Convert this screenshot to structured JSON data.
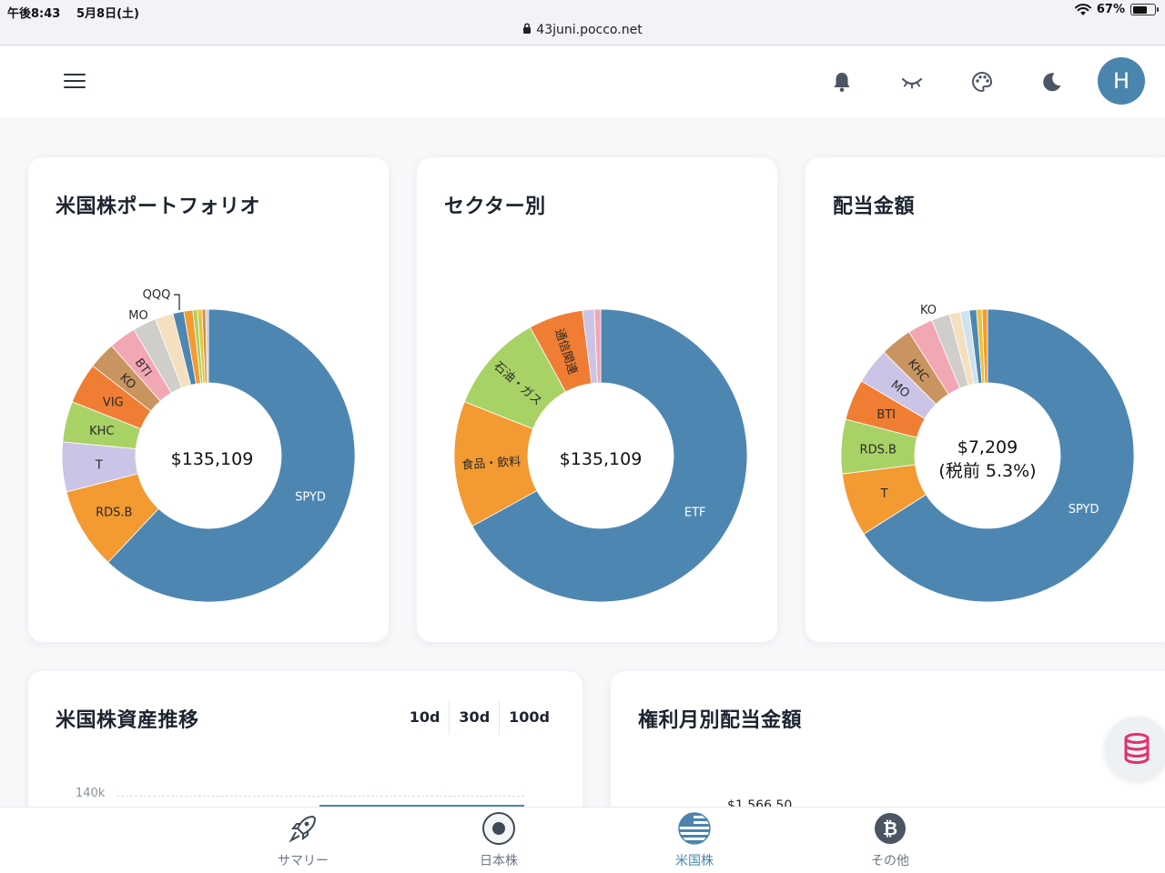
{
  "statusbar": {
    "time": "午後8:43",
    "date": "5月8日(土)",
    "battery": "67%",
    "battery_level": 0.67,
    "url": "43juni.pocco.net"
  },
  "header": {
    "avatar_letter": "H"
  },
  "cards": {
    "portfolio": {
      "title": "米国株ポートフォリオ",
      "center": "$135,109"
    },
    "sector": {
      "title": "セクター別",
      "center": "$135,109"
    },
    "dividend": {
      "title": "配当金額",
      "center_line1": "$7,209",
      "center_line2": "(税前 5.3%)"
    },
    "history": {
      "title": "米国株資産推移",
      "tabs": [
        "10d",
        "30d",
        "100d"
      ],
      "y_tick": "140k"
    },
    "monthly": {
      "title": "権利月別配当金額",
      "first_value": "$1,566.50"
    }
  },
  "chart_data": [
    {
      "type": "pie",
      "title": "米国株ポートフォリオ",
      "categories": [
        "SPYD",
        "RDS.B",
        "T",
        "KHC",
        "VIG",
        "KO",
        "BTI",
        "MO",
        "",
        "QQQ",
        "",
        "",
        "",
        "",
        ""
      ],
      "values": [
        62.0,
        9.0,
        5.5,
        4.5,
        4.5,
        3.0,
        3.0,
        2.6,
        2.0,
        1.2,
        1.0,
        0.5,
        0.5,
        0.4,
        0.3
      ],
      "colors": [
        "#4e86b2",
        "#f39a32",
        "#ccc4e6",
        "#a9d266",
        "#ef7d33",
        "#c9945f",
        "#f2a7b4",
        "#d0cecb",
        "#f4dfbe",
        "#4e86b2",
        "#f39a32",
        "#a9d266",
        "#e9c43a",
        "#d98d3c",
        "#cccccc"
      ],
      "center_label": "$135,109"
    },
    {
      "type": "pie",
      "title": "セクター別",
      "categories": [
        "ETF",
        "食品・飲料",
        "石油・ガス",
        "通信関連",
        "",
        ""
      ],
      "values": [
        67.0,
        14.0,
        11.0,
        6.0,
        1.3,
        0.7
      ],
      "colors": [
        "#4e86b2",
        "#f39a32",
        "#a9d266",
        "#ef7d33",
        "#ccc4e6",
        "#f2a7b4"
      ],
      "center_label": "$135,109"
    },
    {
      "type": "pie",
      "title": "配当金額",
      "categories": [
        "SPYD",
        "T",
        "RDS.B",
        "BTI",
        "MO",
        "KHC",
        "KO",
        "",
        "",
        "",
        "",
        "",
        ""
      ],
      "values": [
        66.0,
        7.0,
        6.0,
        4.5,
        4.0,
        3.5,
        2.8,
        2.0,
        1.2,
        1.0,
        0.8,
        0.6,
        0.6
      ],
      "colors": [
        "#4e86b2",
        "#f39a32",
        "#a9d266",
        "#ef7d33",
        "#ccc4e6",
        "#c9945f",
        "#f2a7b4",
        "#d0cecb",
        "#f4dfbe",
        "#cfe3ef",
        "#4e86b2",
        "#e9c43a",
        "#f39a32"
      ],
      "center_label": "$7,209 (税前 5.3%)"
    }
  ],
  "bottomnav": [
    {
      "label": "サマリー",
      "icon": "rocket-icon",
      "active": false
    },
    {
      "label": "日本株",
      "icon": "japan-flag-icon",
      "active": false
    },
    {
      "label": "米国株",
      "icon": "us-flag-icon",
      "active": true
    },
    {
      "label": "その他",
      "icon": "bitcoin-icon",
      "active": false
    }
  ]
}
